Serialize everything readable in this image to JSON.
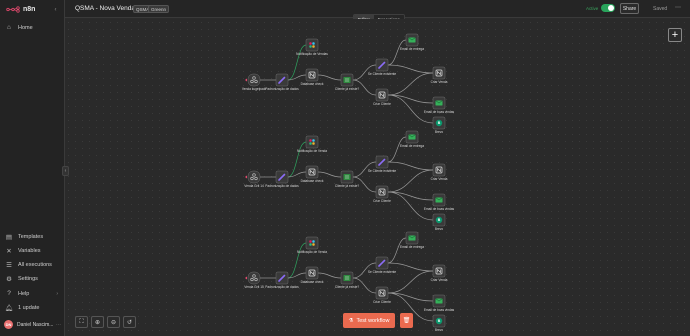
{
  "app": {
    "logo_text": "n8n"
  },
  "sidebar": {
    "items": [
      {
        "label": "Home",
        "icon": "home-icon"
      },
      {
        "label": "Templates",
        "icon": "templates-icon"
      },
      {
        "label": "Variables",
        "icon": "variables-icon"
      },
      {
        "label": "All executions",
        "icon": "executions-icon"
      },
      {
        "label": "Settings",
        "icon": "gear-icon"
      },
      {
        "label": "Help",
        "icon": "help-icon"
      },
      {
        "label": "1 update",
        "icon": "bell-icon"
      }
    ],
    "user": {
      "name": "Daniel Nascim...",
      "initials": "DN"
    }
  },
  "header": {
    "workflow_name": "QSMA - Nova Venda",
    "tags": [
      "QSMA",
      "Greenn"
    ],
    "active_label": "Active",
    "share_label": "Share",
    "saved_label": "Saved"
  },
  "tabs": [
    {
      "label": "Editor",
      "active": true
    },
    {
      "label": "Executions",
      "active": false
    }
  ],
  "canvas": {
    "test_workflow_label": "Test workflow",
    "rows": [
      {
        "trigger": "Venda kugelpack",
        "normalize": "Padronização de dados",
        "notify": "Notificação de Vendas",
        "db": "Database check",
        "filter": "Cliente já existe?",
        "if_node": "Se Cliente existente",
        "create": "Criar Cliente",
        "email_delivery": "Email de entrega",
        "create_sale": "Criar Venda",
        "welcome_email": "Email de boas vindas",
        "brevo": "Brevo"
      },
      {
        "trigger": "Venda Grit 14",
        "normalize": "Padronização de dados",
        "notify": "Notificação de Venda",
        "db": "Database check",
        "filter": "Cliente já existe?",
        "if_node": "Se Cliente existente",
        "create": "Criar Cliente",
        "email_delivery": "Email de entrega",
        "create_sale": "Criar Venda",
        "welcome_email": "Email de boas vindas",
        "brevo": "Brevo"
      },
      {
        "trigger": "Venda Grit 15",
        "normalize": "Padronização de dados",
        "notify": "Notificação de Venda",
        "db": "Database check",
        "filter": "Cliente já existe?",
        "if_node": "Se Cliente existente",
        "create": "Criar Cliente",
        "email_delivery": "Email de entrega",
        "create_sale": "Criar Venda",
        "welcome_email": "Email de boas vindas",
        "brevo": "Brevo"
      }
    ]
  },
  "colors": {
    "accent": "#ea6a4f",
    "active": "#29a35b",
    "node_bg": "#3a3a3a",
    "edit_icon": "#8b6cf6",
    "email_icon": "#35b15a",
    "slack": "#e01e5a"
  }
}
